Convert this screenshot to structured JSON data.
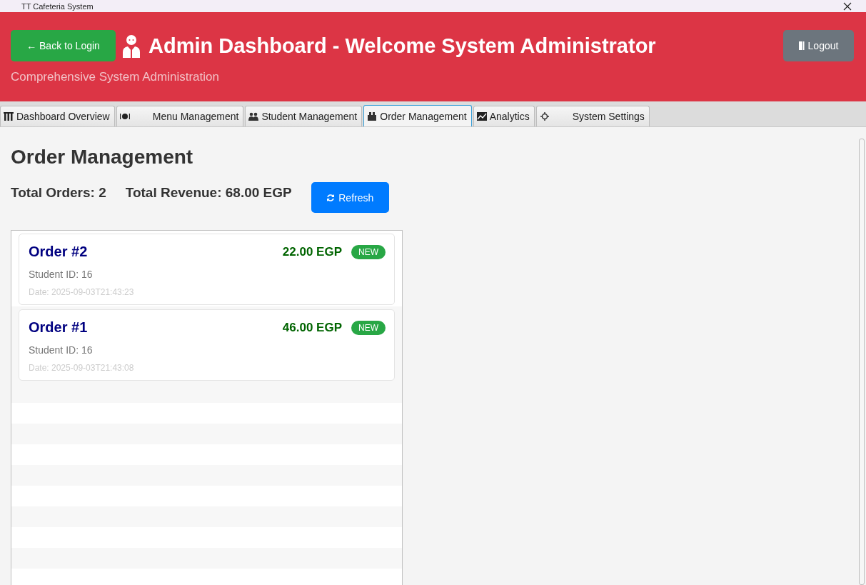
{
  "window": {
    "title": "TT Cafeteria System"
  },
  "header": {
    "back_button": "← Back to Login",
    "title": "Admin Dashboard - Welcome System Administrator",
    "subtitle": "Comprehensive System Administration",
    "logout_button": "Logout"
  },
  "tabs": [
    {
      "label": "Dashboard Overview",
      "selected": false
    },
    {
      "label": "Menu Management",
      "selected": false
    },
    {
      "label": "Student Management",
      "selected": false
    },
    {
      "label": "Order Management",
      "selected": true
    },
    {
      "label": "Analytics",
      "selected": false
    },
    {
      "label": "System Settings",
      "selected": false
    }
  ],
  "page": {
    "title": "Order Management",
    "total_orders": "Total Orders: 2",
    "total_revenue": "Total Revenue: 68.00 EGP",
    "refresh_button": "Refresh"
  },
  "orders": [
    {
      "title": "Order #2",
      "amount": "22.00 EGP",
      "status": "NEW",
      "student": "Student ID: 16",
      "date": "Date: 2025-09-03T21:43:23"
    },
    {
      "title": "Order #1",
      "amount": "46.00 EGP",
      "status": "NEW",
      "student": "Student ID: 16",
      "date": "Date: 2025-09-03T21:43:08"
    }
  ]
}
